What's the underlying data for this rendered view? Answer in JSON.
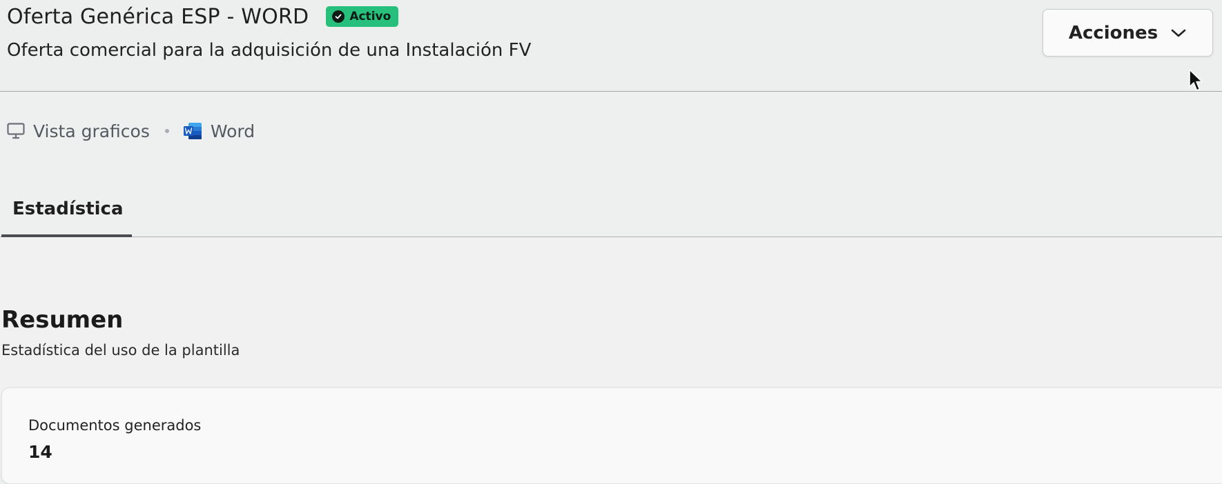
{
  "header": {
    "title": "Oferta Genérica ESP - WORD",
    "status": "Activo",
    "subtitle": "Oferta comercial para la adquisición de una Instalación FV",
    "actions_label": "Acciones"
  },
  "meta": {
    "view_label": "Vista graficos",
    "format_label": "Word"
  },
  "tabs": [
    {
      "label": "Estadística",
      "active": true
    }
  ],
  "summary": {
    "title": "Resumen",
    "subtitle": "Estadística del uso de la plantilla",
    "cards": [
      {
        "label": "Documentos generados",
        "value": "14"
      }
    ]
  },
  "colors": {
    "status_badge": "#26c07c",
    "word_blue": "#185abd"
  },
  "icons": [
    "check-circle-icon",
    "chevron-down-icon",
    "monitor-icon",
    "word-icon",
    "cursor-icon"
  ]
}
